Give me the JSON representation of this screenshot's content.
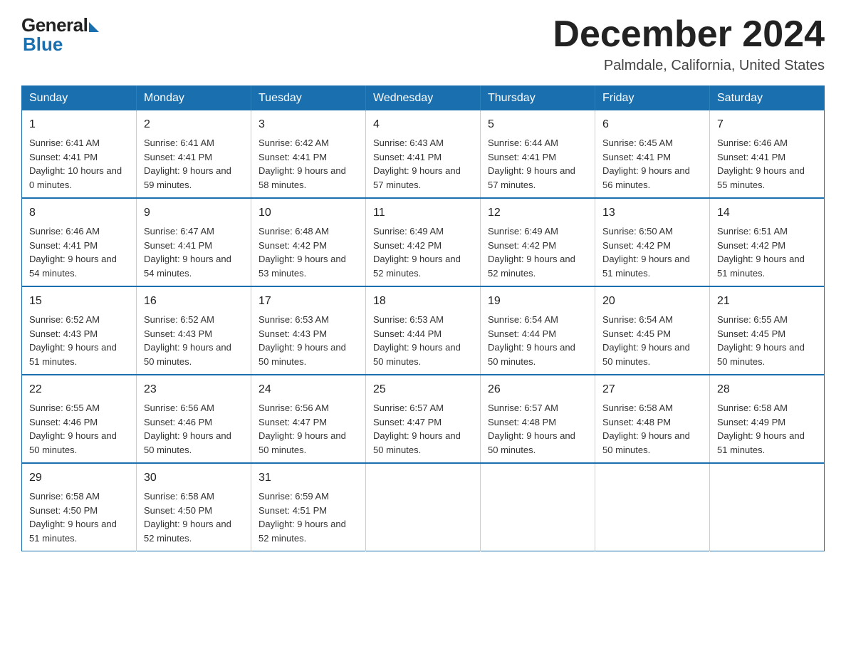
{
  "logo": {
    "general": "General",
    "blue": "Blue"
  },
  "header": {
    "month": "December 2024",
    "location": "Palmdale, California, United States"
  },
  "weekdays": [
    "Sunday",
    "Monday",
    "Tuesday",
    "Wednesday",
    "Thursday",
    "Friday",
    "Saturday"
  ],
  "weeks": [
    [
      {
        "day": "1",
        "sunrise": "6:41 AM",
        "sunset": "4:41 PM",
        "daylight": "10 hours and 0 minutes."
      },
      {
        "day": "2",
        "sunrise": "6:41 AM",
        "sunset": "4:41 PM",
        "daylight": "9 hours and 59 minutes."
      },
      {
        "day": "3",
        "sunrise": "6:42 AM",
        "sunset": "4:41 PM",
        "daylight": "9 hours and 58 minutes."
      },
      {
        "day": "4",
        "sunrise": "6:43 AM",
        "sunset": "4:41 PM",
        "daylight": "9 hours and 57 minutes."
      },
      {
        "day": "5",
        "sunrise": "6:44 AM",
        "sunset": "4:41 PM",
        "daylight": "9 hours and 57 minutes."
      },
      {
        "day": "6",
        "sunrise": "6:45 AM",
        "sunset": "4:41 PM",
        "daylight": "9 hours and 56 minutes."
      },
      {
        "day": "7",
        "sunrise": "6:46 AM",
        "sunset": "4:41 PM",
        "daylight": "9 hours and 55 minutes."
      }
    ],
    [
      {
        "day": "8",
        "sunrise": "6:46 AM",
        "sunset": "4:41 PM",
        "daylight": "9 hours and 54 minutes."
      },
      {
        "day": "9",
        "sunrise": "6:47 AM",
        "sunset": "4:41 PM",
        "daylight": "9 hours and 54 minutes."
      },
      {
        "day": "10",
        "sunrise": "6:48 AM",
        "sunset": "4:42 PM",
        "daylight": "9 hours and 53 minutes."
      },
      {
        "day": "11",
        "sunrise": "6:49 AM",
        "sunset": "4:42 PM",
        "daylight": "9 hours and 52 minutes."
      },
      {
        "day": "12",
        "sunrise": "6:49 AM",
        "sunset": "4:42 PM",
        "daylight": "9 hours and 52 minutes."
      },
      {
        "day": "13",
        "sunrise": "6:50 AM",
        "sunset": "4:42 PM",
        "daylight": "9 hours and 51 minutes."
      },
      {
        "day": "14",
        "sunrise": "6:51 AM",
        "sunset": "4:42 PM",
        "daylight": "9 hours and 51 minutes."
      }
    ],
    [
      {
        "day": "15",
        "sunrise": "6:52 AM",
        "sunset": "4:43 PM",
        "daylight": "9 hours and 51 minutes."
      },
      {
        "day": "16",
        "sunrise": "6:52 AM",
        "sunset": "4:43 PM",
        "daylight": "9 hours and 50 minutes."
      },
      {
        "day": "17",
        "sunrise": "6:53 AM",
        "sunset": "4:43 PM",
        "daylight": "9 hours and 50 minutes."
      },
      {
        "day": "18",
        "sunrise": "6:53 AM",
        "sunset": "4:44 PM",
        "daylight": "9 hours and 50 minutes."
      },
      {
        "day": "19",
        "sunrise": "6:54 AM",
        "sunset": "4:44 PM",
        "daylight": "9 hours and 50 minutes."
      },
      {
        "day": "20",
        "sunrise": "6:54 AM",
        "sunset": "4:45 PM",
        "daylight": "9 hours and 50 minutes."
      },
      {
        "day": "21",
        "sunrise": "6:55 AM",
        "sunset": "4:45 PM",
        "daylight": "9 hours and 50 minutes."
      }
    ],
    [
      {
        "day": "22",
        "sunrise": "6:55 AM",
        "sunset": "4:46 PM",
        "daylight": "9 hours and 50 minutes."
      },
      {
        "day": "23",
        "sunrise": "6:56 AM",
        "sunset": "4:46 PM",
        "daylight": "9 hours and 50 minutes."
      },
      {
        "day": "24",
        "sunrise": "6:56 AM",
        "sunset": "4:47 PM",
        "daylight": "9 hours and 50 minutes."
      },
      {
        "day": "25",
        "sunrise": "6:57 AM",
        "sunset": "4:47 PM",
        "daylight": "9 hours and 50 minutes."
      },
      {
        "day": "26",
        "sunrise": "6:57 AM",
        "sunset": "4:48 PM",
        "daylight": "9 hours and 50 minutes."
      },
      {
        "day": "27",
        "sunrise": "6:58 AM",
        "sunset": "4:48 PM",
        "daylight": "9 hours and 50 minutes."
      },
      {
        "day": "28",
        "sunrise": "6:58 AM",
        "sunset": "4:49 PM",
        "daylight": "9 hours and 51 minutes."
      }
    ],
    [
      {
        "day": "29",
        "sunrise": "6:58 AM",
        "sunset": "4:50 PM",
        "daylight": "9 hours and 51 minutes."
      },
      {
        "day": "30",
        "sunrise": "6:58 AM",
        "sunset": "4:50 PM",
        "daylight": "9 hours and 52 minutes."
      },
      {
        "day": "31",
        "sunrise": "6:59 AM",
        "sunset": "4:51 PM",
        "daylight": "9 hours and 52 minutes."
      },
      null,
      null,
      null,
      null
    ]
  ],
  "labels": {
    "sunrise": "Sunrise:",
    "sunset": "Sunset:",
    "daylight": "Daylight:"
  }
}
